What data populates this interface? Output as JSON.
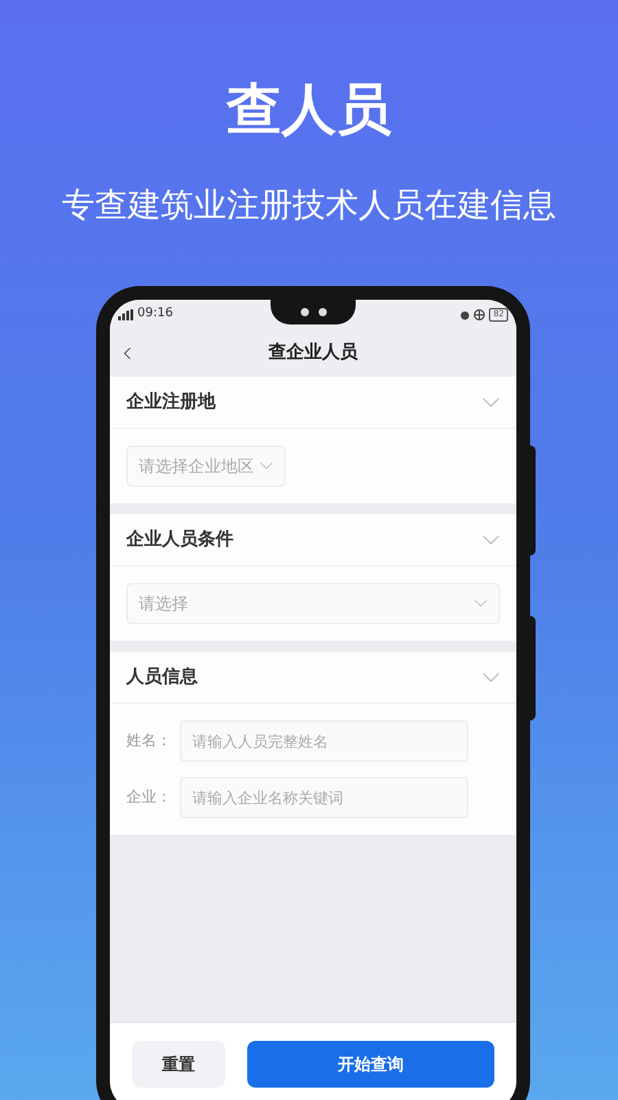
{
  "hero": {
    "title": "查人员",
    "subtitle": "专查建筑业注册技术人员在建信息"
  },
  "status_bar": {
    "time": "09:16",
    "battery": "82"
  },
  "nav": {
    "title": "查企业人员"
  },
  "sections": [
    {
      "title": "企业注册地",
      "kind": "select",
      "select": {
        "placeholder": "请选择企业地区",
        "full_width": false
      }
    },
    {
      "title": "企业人员条件",
      "kind": "select",
      "select": {
        "placeholder": "请选择",
        "full_width": true
      }
    },
    {
      "title": "人员信息",
      "kind": "fields",
      "fields": [
        {
          "label": "姓名：",
          "placeholder": "请输入人员完整姓名"
        },
        {
          "label": "企业：",
          "placeholder": "请输入企业名称关键词"
        }
      ]
    }
  ],
  "buttons": [
    {
      "label": "重置",
      "kind": "secondary"
    },
    {
      "label": "开始查询",
      "kind": "primary"
    }
  ]
}
